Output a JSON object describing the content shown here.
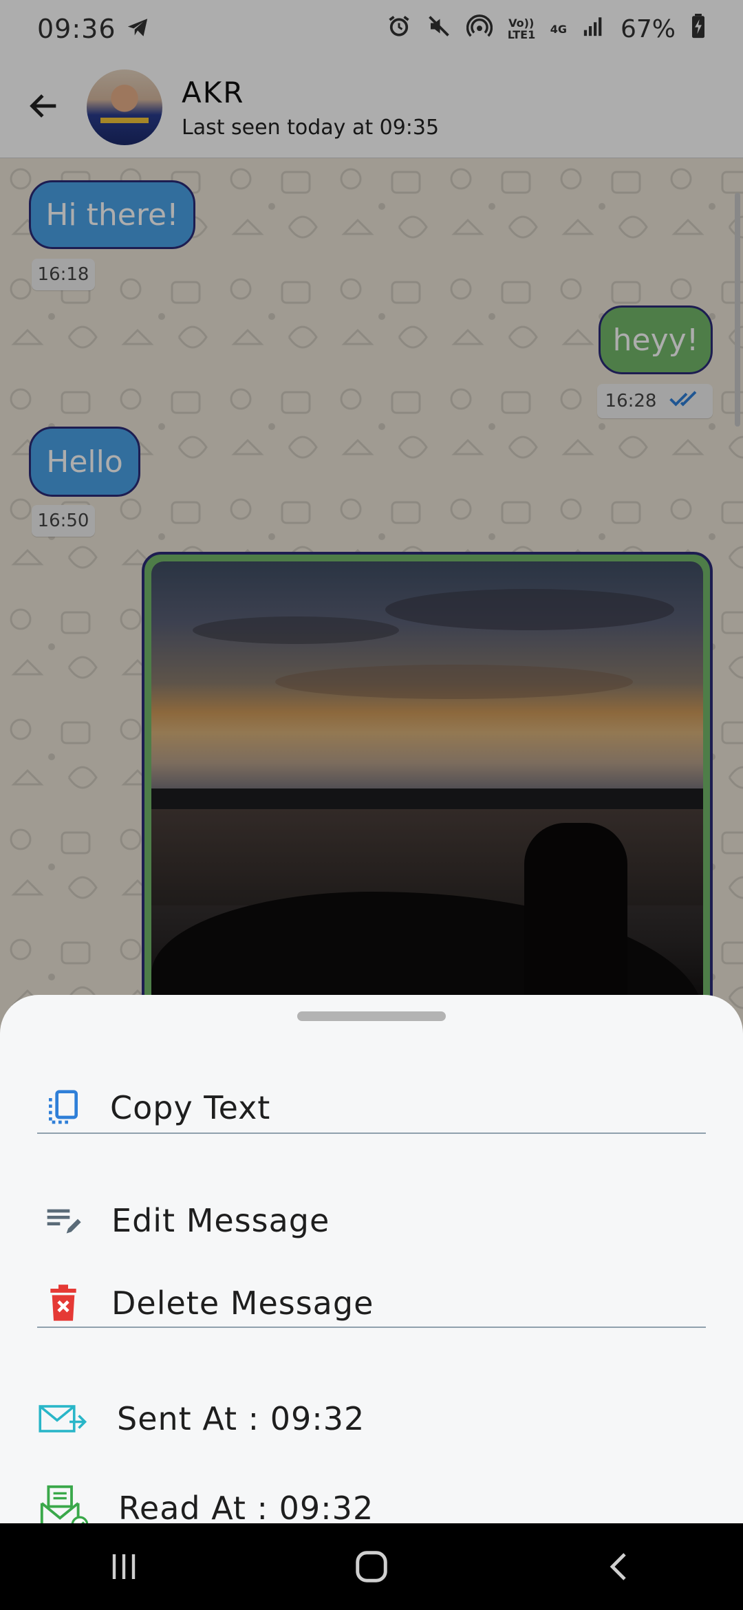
{
  "status_bar": {
    "time": "09:36",
    "volte": "Vo)) LTE1",
    "network": "4G",
    "battery": "67%"
  },
  "header": {
    "contact_name": "AKR",
    "last_seen": "Last seen today at 09:35"
  },
  "messages": [
    {
      "text": "Hi there!",
      "time": "16:18",
      "direction": "in"
    },
    {
      "text": "heyy!",
      "time": "16:28",
      "direction": "out",
      "read_ticks": "double-check-icon"
    },
    {
      "text": "Hello",
      "time": "16:50",
      "direction": "in"
    }
  ],
  "sheet": {
    "copy_label": "Copy Text",
    "edit_label": "Edit Message",
    "delete_label": "Delete Message",
    "sent_at": "Sent At : 09:32",
    "read_at": "Read At : 09:32"
  },
  "colors": {
    "incoming_bubble": "#4aa3e8",
    "outgoing_bubble": "#73b86b",
    "bubble_border": "#2b2b78",
    "delete_red": "#e53935",
    "icon_blue": "#2f7fd8"
  }
}
